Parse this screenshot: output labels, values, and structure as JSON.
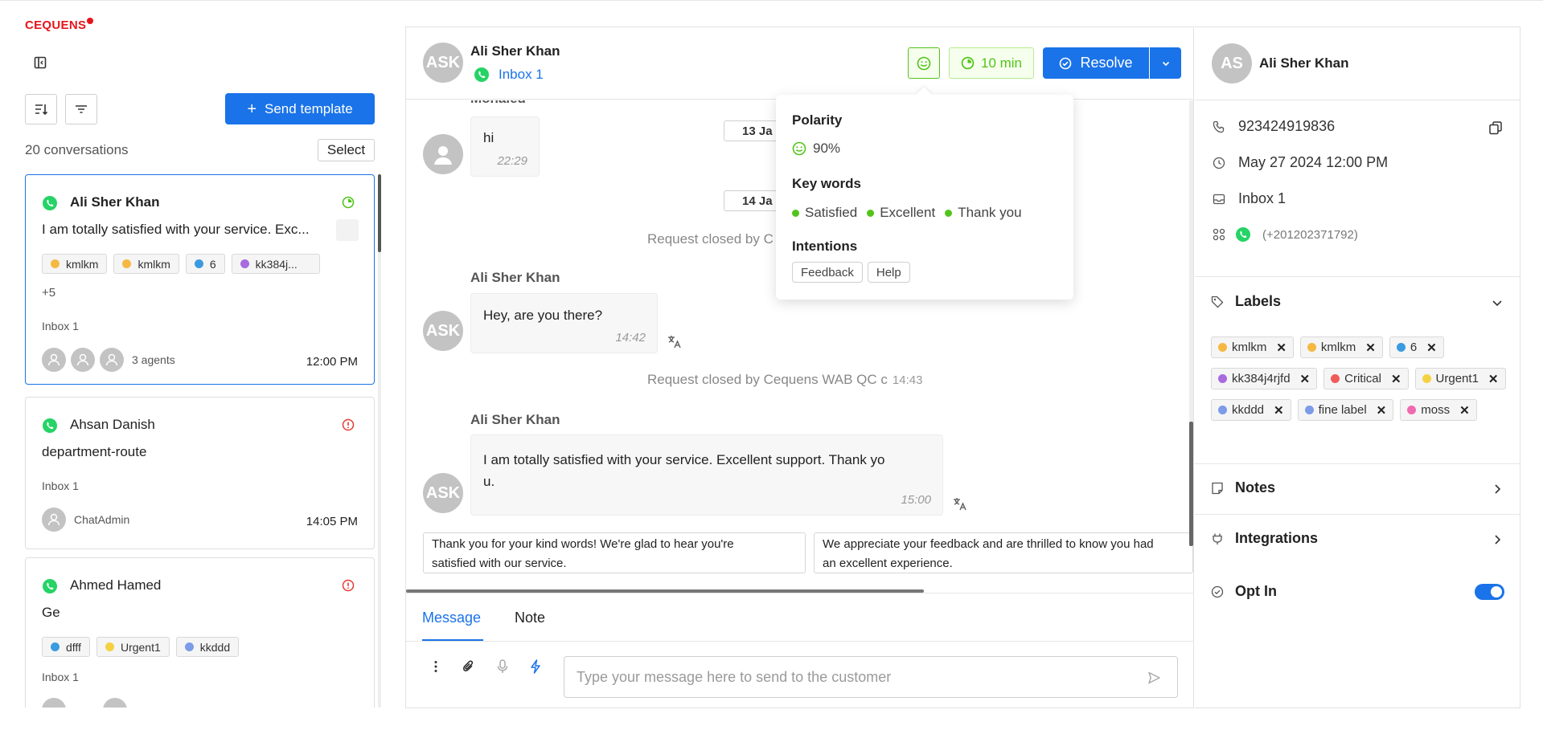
{
  "brand": {
    "logo_text": "CEQUENS"
  },
  "left": {
    "send_template_label": "Send template",
    "conversation_count": "20 conversations",
    "select_label": "Select",
    "conversations": [
      {
        "name": "Ali Sher Khan",
        "preview": "I am totally satisfied with your service. Exc...",
        "tags": [
          {
            "label": "kmlkm",
            "color": "#f5b942"
          },
          {
            "label": "kmlkm",
            "color": "#f5b942"
          },
          {
            "label": "6",
            "color": "#3b9be0"
          },
          {
            "label": "kk384j...",
            "color": "#a86ae0"
          }
        ],
        "more": "+5",
        "inbox": "Inbox 1",
        "agents": "3 agents",
        "time": "12:00 PM"
      },
      {
        "name": "Ahsan Danish",
        "preview": "department-route",
        "inbox": "Inbox 1",
        "agent": "ChatAdmin",
        "time": "14:05 PM"
      },
      {
        "name": "Ahmed Hamed",
        "preview": "Ge",
        "tags": [
          {
            "label": "dfff",
            "color": "#3b9be0"
          },
          {
            "label": "Urgent1",
            "color": "#f5d142"
          },
          {
            "label": "kkddd",
            "color": "#7c9be8"
          }
        ],
        "inbox": "Inbox 1"
      }
    ]
  },
  "chat": {
    "header": {
      "avatar": "ASK",
      "name": "Ali Sher Khan",
      "inbox": "Inbox 1",
      "timer": "10 min",
      "resolve_label": "Resolve"
    },
    "partial_sender": "Mohaled",
    "messages": [
      {
        "text": "hi",
        "time": "22:29"
      },
      {
        "text": "Hey, are you there?",
        "time": "14:42"
      },
      {
        "text": "I am totally satisfied with your service. Excellent support. Thank yo",
        "text2": "u.",
        "time": "15:00"
      }
    ],
    "date_pill_1": "13 Ja",
    "date_pill_2": "14 Ja",
    "sys_1": "Request closed by C",
    "sys_2": "Request closed by Cequens WAB QC c",
    "sys_2_time": "14:43",
    "sender_name": "Ali Sher Khan",
    "avatar": "ASK",
    "suggestions": [
      {
        "line1": "Thank you for your kind words! We're glad to hear you're",
        "line2": "satisfied with our service."
      },
      {
        "line1": "We appreciate your feedback and are thrilled to know you had",
        "line2": "an excellent experience."
      }
    ],
    "tabs": {
      "message": "Message",
      "note": "Note"
    },
    "input_placeholder": "Type your message here to send to the customer"
  },
  "popover": {
    "polarity_title": "Polarity",
    "polarity_value": "90%",
    "keywords_title": "Key words",
    "keywords": [
      "Satisfied",
      "Excellent",
      "Thank you"
    ],
    "intentions_title": "Intentions",
    "intentions": [
      "Feedback",
      "Help"
    ]
  },
  "contact": {
    "avatar": "AS",
    "name": "Ali Sher Khan",
    "phone": "923424919836",
    "date": "May 27 2024 12:00 PM",
    "inbox": "Inbox 1",
    "channel_number": "(+201202371792)",
    "labels_title": "Labels",
    "labels": [
      {
        "label": "kmlkm",
        "color": "#f5b942"
      },
      {
        "label": "kmlkm",
        "color": "#f5b942"
      },
      {
        "label": "6",
        "color": "#3b9be0"
      },
      {
        "label": "kk384j4rjfd",
        "color": "#a86ae0"
      },
      {
        "label": "Critical",
        "color": "#f05a5a"
      },
      {
        "label": "Urgent1",
        "color": "#f5d142"
      },
      {
        "label": "kkddd",
        "color": "#7c9be8"
      },
      {
        "label": "fine label",
        "color": "#7c9be8"
      },
      {
        "label": "moss",
        "color": "#f06ab0"
      }
    ],
    "notes_title": "Notes",
    "integrations_title": "Integrations",
    "opt_in_title": "Opt In",
    "opt_in": true
  },
  "colors": {
    "primary": "#1a73e8",
    "success": "#52c41a",
    "danger": "#e8141b"
  }
}
